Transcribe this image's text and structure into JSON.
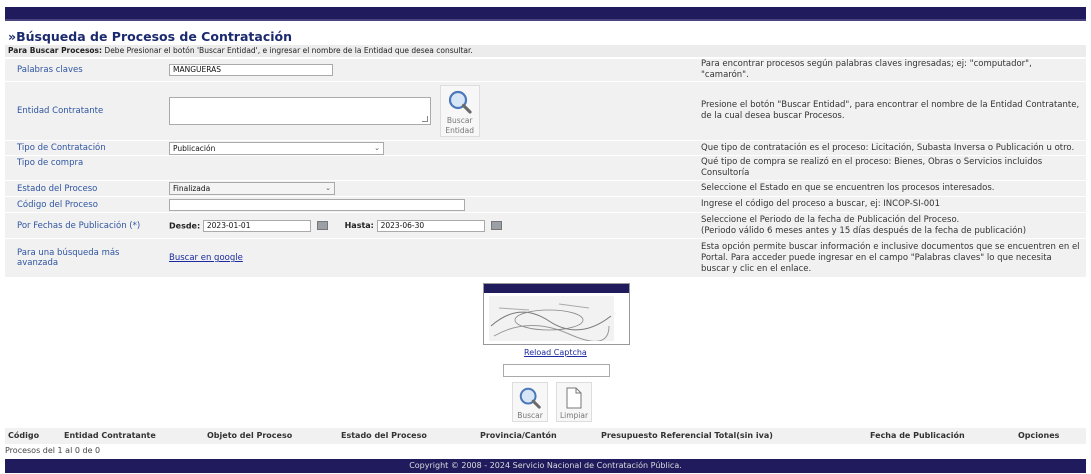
{
  "page": {
    "title": "»Búsqueda de Procesos de Contratación",
    "instruction_bold": "Para Buscar Procesos:",
    "instruction_text": " Debe Presionar el botón 'Buscar Entidad', e ingresar el nombre de la Entidad que desea consultar."
  },
  "form": {
    "keywords": {
      "label": "Palabras claves",
      "value": "MANGUERAS",
      "hint": "Para encontrar procesos según palabras claves ingresadas; ej: \"computador\", \"camarón\"."
    },
    "entity": {
      "label": "Entidad Contratante",
      "value": "",
      "button_label_1": "Buscar",
      "button_label_2": "Entidad",
      "hint": "Presione el botón \"Buscar Entidad\", para encontrar el nombre de la Entidad Contratante, de la cual desea buscar Procesos."
    },
    "contract_type": {
      "label": "Tipo de Contratación",
      "value": "Publicación",
      "hint": "Que tipo de contratación es el proceso: Licitación, Subasta Inversa o Publicación u otro."
    },
    "purchase_type": {
      "label": "Tipo de compra",
      "hint": "Qué tipo de compra se realizó en el proceso: Bienes, Obras o Servicios incluidos Consultoría"
    },
    "status": {
      "label": "Estado del Proceso",
      "value": "Finalizada",
      "hint": "Seleccione el Estado en que se encuentren los procesos interesados."
    },
    "code": {
      "label": "Código del Proceso",
      "value": "",
      "hint": "Ingrese el código del proceso a buscar, ej: INCOP-SI-001"
    },
    "dates": {
      "label": "Por Fechas de Publicación (*)",
      "from_label": "Desde:",
      "from_value": "2023-01-01",
      "to_label": "Hasta:",
      "to_value": "2023-06-30",
      "hint_1": "Seleccione el Periodo de la fecha de Publicación del Proceso.",
      "hint_2": "(Periodo válido 6 meses antes y 15 días después de la fecha de publicación)"
    },
    "advanced": {
      "label": "Para una búsqueda más avanzada",
      "link": "Buscar en google",
      "hint": "Esta opción permite buscar información e inclusive documentos que se encuentren en el Portal. Para acceder puede ingresar en el campo \"Palabras claves\" lo que necesita buscar y clic en el enlace."
    }
  },
  "captcha": {
    "reload": "Reload Captcha",
    "input_value": "",
    "search_label": "Buscar",
    "clear_label": "Limpiar"
  },
  "results": {
    "columns": [
      "Código",
      "Entidad Contratante",
      "Objeto del Proceso",
      "Estado del Proceso",
      "Provincia/Cantón",
      "Presupuesto Referencial Total(sin iva)",
      "Fecha de Publicación",
      "Opciones"
    ],
    "count": "Procesos del 1 al 0 de 0"
  },
  "footer": {
    "text": "Copyright © 2008 - 2024 Servicio Nacional de Contratación Pública."
  },
  "colors": {
    "navy": "#1f1b5c",
    "label_blue": "#2e54a0",
    "row_bg": "#f1f1f1"
  }
}
